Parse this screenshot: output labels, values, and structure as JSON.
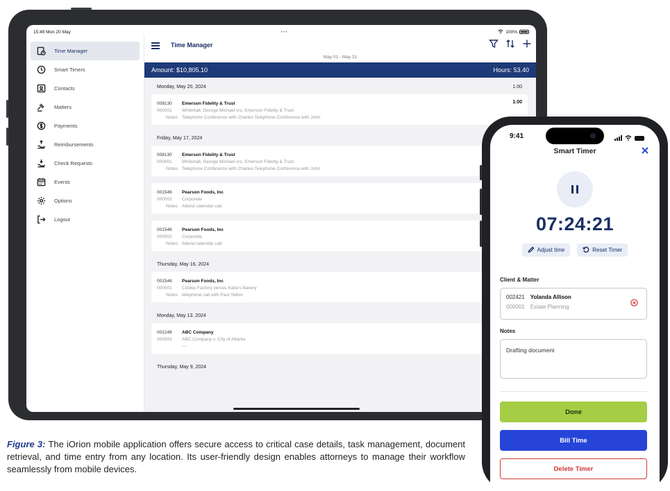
{
  "tablet": {
    "status": {
      "time": "15:49",
      "date": "Mon 20 May",
      "dots": "•••",
      "battery": "100%"
    },
    "sidebar": {
      "items": [
        {
          "label": "Time Manager",
          "icon": "timesheet-icon",
          "active": true
        },
        {
          "label": "Smart Timers",
          "icon": "clock-icon",
          "active": false
        },
        {
          "label": "Contacts",
          "icon": "contact-card-icon",
          "active": false
        },
        {
          "label": "Matters",
          "icon": "gavel-icon",
          "active": false
        },
        {
          "label": "Payments",
          "icon": "dollar-icon",
          "active": false
        },
        {
          "label": "Reimbursements",
          "icon": "reimburse-icon",
          "active": false
        },
        {
          "label": "Check Requests",
          "icon": "hand-money-icon",
          "active": false
        },
        {
          "label": "Events",
          "icon": "calendar-icon",
          "active": false
        },
        {
          "label": "Options",
          "icon": "gear-icon",
          "active": false
        },
        {
          "label": "Logout",
          "icon": "logout-icon",
          "active": false
        }
      ]
    },
    "header": {
      "title": "Time Manager",
      "range": "May 01 - May 31",
      "actions": [
        "filter-icon",
        "sort-icon",
        "plus-icon"
      ]
    },
    "summary": {
      "amount": "Amount: $10,805.10",
      "hours": "Hours: 53.40"
    },
    "groups": [
      {
        "date": "Monday, May 20, 2024",
        "total": "1.00",
        "entries": [
          {
            "code": "008130",
            "client": "Emerson Fidelity & Trust",
            "hours": "1.00",
            "matter_code": "000001",
            "matter": "Whitehall, George Michael vrs. Emerson Fidelity & Trust",
            "notes_label": "Notes",
            "notes": "Telephone Conference with Charles Telephone Conference with John"
          }
        ]
      },
      {
        "date": "Friday, May 17, 2024",
        "total": "",
        "entries": [
          {
            "code": "008130",
            "client": "Emerson Fidelity & Trust",
            "hours": "",
            "matter_code": "000001",
            "matter": "Whitehall, George Michael vrs. Emerson Fidelity & Trust",
            "notes_label": "Notes",
            "notes": "Telephone Conference with Charles Telephone Conference with John"
          },
          {
            "code": "001546",
            "client": "Pearson Foods, Inc",
            "hours": "",
            "matter_code": "000002",
            "matter": "Corporate",
            "notes_label": "Notes",
            "notes": "Attend calendar call;"
          },
          {
            "code": "001546",
            "client": "Pearson Foods, Inc",
            "hours": "",
            "matter_code": "000002",
            "matter": "Corporate",
            "notes_label": "Notes",
            "notes": "Attend calendar call;"
          }
        ]
      },
      {
        "date": "Thursday, May 16, 2024",
        "total": "",
        "entries": [
          {
            "code": "001546",
            "client": "Pearson Foods, Inc",
            "hours": "",
            "matter_code": "000001",
            "matter": "Cookie Factory versus Katie's Bakery",
            "notes_label": "Notes",
            "notes": "telephone call with Paul Yelton"
          }
        ]
      },
      {
        "date": "Monday, May 13, 2024",
        "total": "",
        "entries": [
          {
            "code": "002248",
            "client": "ABC Company",
            "hours": "",
            "matter_code": "000003",
            "matter": "ABC Company v. City of Atlanta",
            "notes_label": "",
            "notes": "---"
          }
        ]
      },
      {
        "date": "Thursday, May 9, 2024",
        "total": "",
        "entries": []
      }
    ]
  },
  "phone": {
    "status": {
      "time": "9:41"
    },
    "title": "Smart Timer",
    "timer": "07:24:21",
    "adjust_label": "Adjust time",
    "reset_label": "Reset Timer",
    "client_matter_label": "Client & Matter",
    "client_code": "002421",
    "client_name": "Yolanda Allison",
    "matter_code": "000001",
    "matter_name": "Estate Planning",
    "notes_label": "Notes",
    "notes_value": "Drafting document",
    "done_label": "Done",
    "bill_label": "Bill Time",
    "delete_label": "Delete Timer",
    "colors": {
      "done": "#a5cd45",
      "bill": "#2744d9",
      "delete": "#d03a3a",
      "brand": "#1b2f66"
    }
  },
  "caption": {
    "figure_label": "Figure 3:",
    "text": " The iOrion mobile application offers secure access to critical case details, task management, document retrieval, and time entry from any location. Its user-friendly design enables attorneys to manage their workflow seamlessly from mobile devices."
  }
}
